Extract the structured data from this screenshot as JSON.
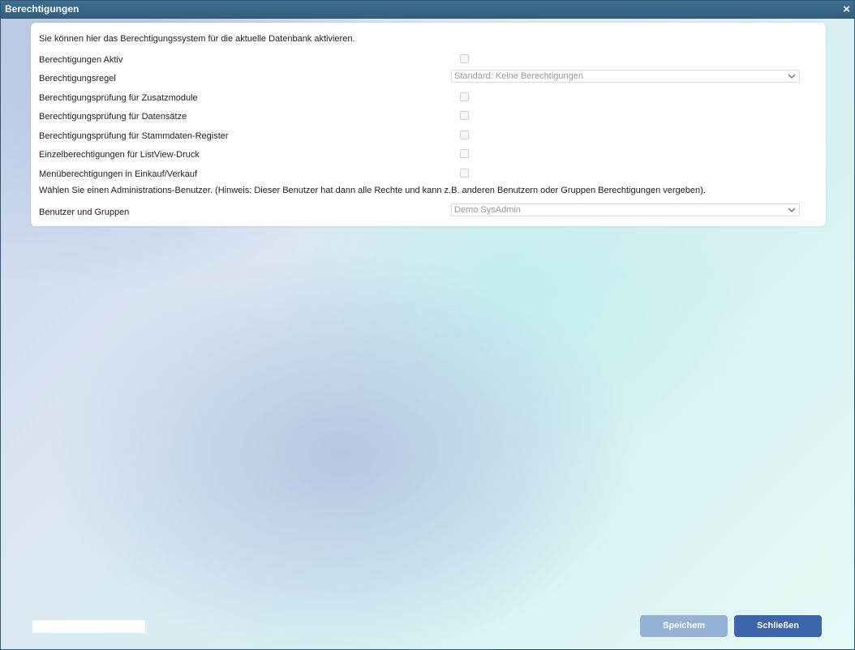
{
  "window": {
    "title": "Berechtigungen",
    "close_glyph": "×"
  },
  "panel": {
    "intro": "Sie können hier das Berechtigungssystem für die aktuelle Datenbank aktivieren.",
    "rows": [
      {
        "label": "Berechtigungen Aktiv",
        "checked": false
      },
      {
        "label": "Berechtigungsregel",
        "select_value": "Standard: Keine Berechtigungen"
      },
      {
        "label": "Berechtigungsprüfung für Zusatzmodule",
        "checked": false
      },
      {
        "label": "Berechtigungsprüfung für Datensätze",
        "checked": false
      },
      {
        "label": "Berechtigungsprüfung für Stammdaten-Register",
        "checked": false
      },
      {
        "label": "Einzelberechtigungen für ListView-Druck",
        "checked": false
      },
      {
        "label": "Menüberechtigungen in Einkauf/Verkauf",
        "checked": false
      }
    ],
    "hint": "Wählen Sie einen Administrations-Benutzer. (Hinweis: Dieser Benutzer hat dann alle Rechte und kann z.B. anderen Benutzern oder Gruppen Berechtigungen vergeben).",
    "users": {
      "label": "Benutzer und Gruppen",
      "select_value": "Demo SysAdmin"
    }
  },
  "footer": {
    "save_label": "Speichem",
    "close_label": "Schließen"
  },
  "icons": {
    "chevron": "chevron-down-icon",
    "close": "close-icon"
  },
  "colors": {
    "titlebar": "#3a6787",
    "save_button": "#95b3d6",
    "close_button": "#3c65ad"
  }
}
